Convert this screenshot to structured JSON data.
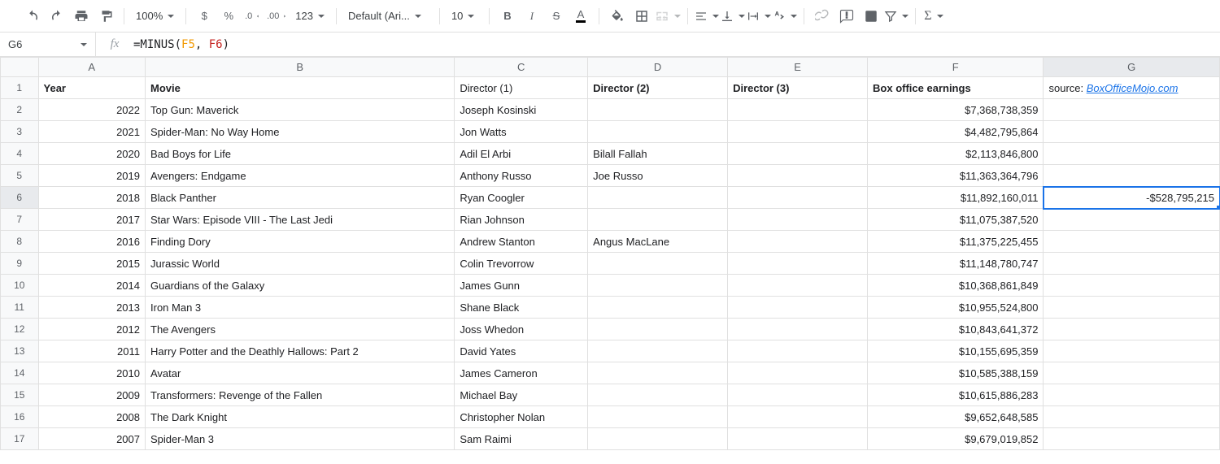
{
  "toolbar": {
    "zoom": "100%",
    "currency": "$",
    "percent": "%",
    "dec_dec": ".0",
    "inc_dec": ".00",
    "more_formats": "123",
    "font": "Default (Ari...",
    "font_size": "10",
    "text_color_letter": "A",
    "icons": {
      "undo": "undo",
      "redo": "redo",
      "print": "print",
      "paint": "paint-format",
      "bold": "bold",
      "italic": "italic",
      "strike": "strike",
      "fill": "fill-color",
      "borders": "borders",
      "merge": "merge-cells",
      "halign": "h-align",
      "valign": "v-align",
      "wrap": "text-wrap",
      "rotate": "text-rotate",
      "link": "insert-link",
      "comment": "insert-comment",
      "chart": "insert-chart",
      "filter": "filter",
      "functions": "functions"
    }
  },
  "namebox": "G6",
  "formula": {
    "raw": "=MINUS(F5, F6)",
    "prefix": "=MINUS(",
    "ref1": "F5",
    "sep": ", ",
    "ref2": "F6",
    "suffix": ")"
  },
  "columns": [
    "A",
    "B",
    "C",
    "D",
    "E",
    "F",
    "G"
  ],
  "headers": {
    "A": "Year",
    "B": "Movie",
    "C": "Director (1)",
    "D": "Director (2)",
    "E": "Director (3)",
    "F": "Box office earnings",
    "G_prefix": "source: ",
    "G_link": "BoxOfficeMojo.com"
  },
  "rows": [
    {
      "n": 2,
      "A": "2022",
      "B": "Top Gun: Maverick",
      "C": "Joseph Kosinski",
      "D": "",
      "E": "",
      "F": "$7,368,738,359",
      "G": ""
    },
    {
      "n": 3,
      "A": "2021",
      "B": "Spider-Man: No Way Home",
      "C": "Jon Watts",
      "D": "",
      "E": "",
      "F": "$4,482,795,864",
      "G": ""
    },
    {
      "n": 4,
      "A": "2020",
      "B": "Bad Boys for Life",
      "C": "Adil El Arbi",
      "D": "Bilall Fallah",
      "E": "",
      "F": "$2,113,846,800",
      "G": ""
    },
    {
      "n": 5,
      "A": "2019",
      "B": "Avengers: Endgame",
      "C": "Anthony Russo",
      "D": "Joe Russo",
      "E": "",
      "F": "$11,363,364,796",
      "G": ""
    },
    {
      "n": 6,
      "A": "2018",
      "B": "Black Panther",
      "C": "Ryan Coogler",
      "D": "",
      "E": "",
      "F": "$11,892,160,011",
      "G": "-$528,795,215"
    },
    {
      "n": 7,
      "A": "2017",
      "B": "Star Wars: Episode VIII - The Last Jedi",
      "C": "Rian Johnson",
      "D": "",
      "E": "",
      "F": "$11,075,387,520",
      "G": ""
    },
    {
      "n": 8,
      "A": "2016",
      "B": "Finding Dory",
      "C": "Andrew Stanton",
      "D": "Angus MacLane",
      "E": "",
      "F": "$11,375,225,455",
      "G": ""
    },
    {
      "n": 9,
      "A": "2015",
      "B": "Jurassic World",
      "C": "Colin Trevorrow",
      "D": "",
      "E": "",
      "F": "$11,148,780,747",
      "G": ""
    },
    {
      "n": 10,
      "A": "2014",
      "B": "Guardians of the Galaxy",
      "C": "James Gunn",
      "D": "",
      "E": "",
      "F": "$10,368,861,849",
      "G": ""
    },
    {
      "n": 11,
      "A": "2013",
      "B": "Iron Man 3",
      "C": "Shane Black",
      "D": "",
      "E": "",
      "F": "$10,955,524,800",
      "G": ""
    },
    {
      "n": 12,
      "A": "2012",
      "B": "The Avengers",
      "C": "Joss Whedon",
      "D": "",
      "E": "",
      "F": "$10,843,641,372",
      "G": ""
    },
    {
      "n": 13,
      "A": "2011",
      "B": "Harry Potter and the Deathly Hallows: Part 2",
      "C": "David Yates",
      "D": "",
      "E": "",
      "F": "$10,155,695,359",
      "G": ""
    },
    {
      "n": 14,
      "A": "2010",
      "B": "Avatar",
      "C": "James Cameron",
      "D": "",
      "E": "",
      "F": "$10,585,388,159",
      "G": ""
    },
    {
      "n": 15,
      "A": "2009",
      "B": "Transformers: Revenge of the Fallen",
      "C": "Michael Bay",
      "D": "",
      "E": "",
      "F": "$10,615,886,283",
      "G": ""
    },
    {
      "n": 16,
      "A": "2008",
      "B": "The Dark Knight",
      "C": "Christopher Nolan",
      "D": "",
      "E": "",
      "F": "$9,652,648,585",
      "G": ""
    },
    {
      "n": 17,
      "A": "2007",
      "B": "Spider-Man 3",
      "C": "Sam Raimi",
      "D": "",
      "E": "",
      "F": "$9,679,019,852",
      "G": ""
    }
  ],
  "selected_cell": "G6"
}
